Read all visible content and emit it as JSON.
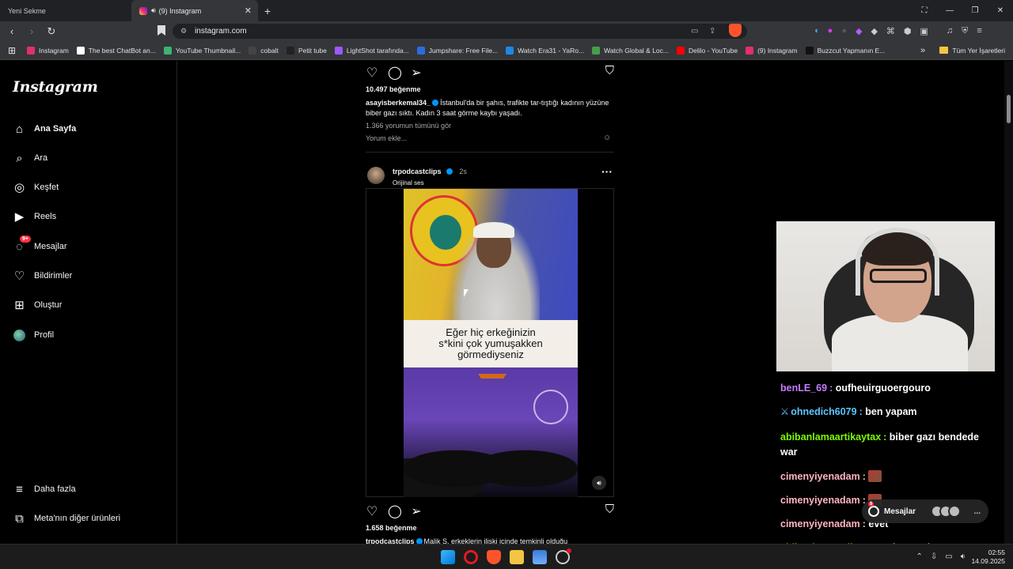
{
  "browser": {
    "tabs": [
      {
        "title": "Yeni Sekme",
        "active": false
      },
      {
        "title": "(9) Instagram",
        "active": true
      }
    ],
    "url": "instagram.com",
    "bookmarks": [
      {
        "label": "Instagram",
        "color": "#e1306c"
      },
      {
        "label": "The best ChatBot an...",
        "color": "#ffffff"
      },
      {
        "label": "YouTube Thumbnail...",
        "color": "#3cb371"
      },
      {
        "label": "cobalt",
        "color": "#444444"
      },
      {
        "label": "Petit tube",
        "color": "#222222"
      },
      {
        "label": "LightShot tarafında...",
        "color": "#9b59ff"
      },
      {
        "label": "Jumpshare: Free File...",
        "color": "#2b6cdf"
      },
      {
        "label": "Watch Era31 - YaRo...",
        "color": "#1e88e5"
      },
      {
        "label": "Watch Global & Loc...",
        "color": "#43a047"
      },
      {
        "label": "Delilo - YouTube",
        "color": "#ff0000"
      },
      {
        "label": "(9) Instagram",
        "color": "#e1306c"
      },
      {
        "label": "Buzzcut Yapmanın E...",
        "color": "#111111"
      }
    ],
    "bookmarks_folder": "Tüm Yer İşaretleri"
  },
  "instagram": {
    "logo": "Instagram",
    "nav": [
      {
        "label": "Ana Sayfa",
        "icon": "home-icon",
        "bold": true
      },
      {
        "label": "Ara",
        "icon": "search-icon"
      },
      {
        "label": "Keşfet",
        "icon": "compass-icon"
      },
      {
        "label": "Reels",
        "icon": "reels-icon"
      },
      {
        "label": "Mesajlar",
        "icon": "messenger-icon",
        "badge": "9+"
      },
      {
        "label": "Bildirimler",
        "icon": "heart-icon"
      },
      {
        "label": "Oluştur",
        "icon": "plus-square-icon"
      },
      {
        "label": "Profil",
        "icon": "avatar"
      }
    ],
    "more": {
      "label": "Daha fazla",
      "icon": "hamburger-icon"
    },
    "meta": {
      "label": "Meta'nın diğer ürünleri",
      "icon": "meta-products-icon"
    }
  },
  "post1": {
    "likes": "10.497 beğenme",
    "user": "asayisberkemal34_",
    "caption": "İstanbul'da bir şahıs, trafikte tar-tıştığı kadının yüzüne biber gazı sıktı. Kadın 3 saat görme kaybı yaşadı.",
    "comments_link": "1.366 yorumun tümünü gör",
    "comment_placeholder": "Yorum ekle..."
  },
  "post2": {
    "user": "trpodcastclips",
    "time": "2s",
    "audio": "Orijinal ses",
    "subtitle": [
      "Eğer hiç erkeğinizin",
      "s*kini çok yumuşakken",
      "görmediyseniz"
    ],
    "likes": "1.658 beğenme",
    "caption": "Malik S. erkeklerin ilişki içinde temkinli olduğu"
  },
  "chat": [
    {
      "user": "benLE_69",
      "color": "#c77dff",
      "msg": "oufheuirguoergouro"
    },
    {
      "user": "ohnedich6079",
      "color": "#5dc5ff",
      "msg": "ben yapam",
      "badge": "sword"
    },
    {
      "user": "abibanlamaartikaytax",
      "color": "#7cfc00",
      "msg": "biber gazı bendede war"
    },
    {
      "user": "cimenyiyenadam",
      "color": "#ffb3c1",
      "msg": "",
      "emote": true
    },
    {
      "user": "cimenyiyenadam",
      "color": "#ffb3c1",
      "msg": "",
      "emote": true
    },
    {
      "user": "cimenyiyenadam",
      "color": "#ffb3c1",
      "msg": "evet"
    },
    {
      "user": "abibanlamaartikaytax",
      "color": "#7cfc00",
      "msg": "düşmanlarım var"
    }
  ],
  "messages_bubble": {
    "label": "Mesajlar",
    "more": "..."
  },
  "taskbar": {
    "time": "02:55",
    "date": "14.09.2025"
  }
}
